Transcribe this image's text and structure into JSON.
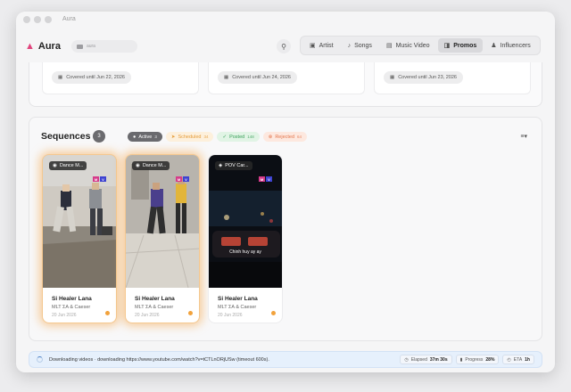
{
  "window": {
    "title": "Aura"
  },
  "header": {
    "logo_text": "Aura",
    "search_placeholder": "aura",
    "nav": [
      {
        "label": "Artist",
        "icon": "contact-card-icon",
        "active": false
      },
      {
        "label": "Songs",
        "icon": "music-note-icon",
        "active": false
      },
      {
        "label": "Music Video",
        "icon": "video-icon",
        "active": false
      },
      {
        "label": "Promos",
        "icon": "megaphone-icon",
        "active": true
      },
      {
        "label": "Influencers",
        "icon": "users-icon",
        "active": false
      }
    ]
  },
  "promo_cards": [
    {
      "coverage": "Covered until Jun 22, 2026"
    },
    {
      "coverage": "Covered until Jun 24, 2026"
    },
    {
      "coverage": "Covered until Jun 23, 2026"
    }
  ],
  "sequences": {
    "title": "Sequences",
    "count": "3",
    "filters": [
      {
        "label": "Active",
        "count": "3"
      },
      {
        "label": "Scheduled",
        "count": "34"
      },
      {
        "label": "Posted",
        "count": "148"
      },
      {
        "label": "Rejected",
        "count": "64"
      }
    ],
    "cards": [
      {
        "badge": "Dance M...",
        "mv_m": "M",
        "mv_v": "V",
        "title": "Si Healer Lana",
        "artist": "MLT ΣA & Caeser",
        "date": "20 Jun 2026",
        "caption": ""
      },
      {
        "badge": "Dance M...",
        "mv_m": "M",
        "mv_v": "V",
        "title": "Si Healer Lana",
        "artist": "MLT ΣA & Caeser",
        "date": "20 Jun 2026",
        "caption": ""
      },
      {
        "badge": "POV Car...",
        "mv_m": "M",
        "mv_v": "V",
        "title": "Si Healer Lana",
        "artist": "MLT ΣA & Caeser",
        "date": "20 Jun 2026",
        "caption": "Chinh huy ay ay"
      }
    ]
  },
  "statusbar": {
    "message": "Downloading videos · downloading https://www.youtube.com/watch?v=tCTLnORjUSw (timeout 600s).",
    "elapsed_label": "Elapsed",
    "elapsed_value": "37m 30s",
    "progress_label": "Progress",
    "progress_value": "28%",
    "eta_label": "ETA",
    "eta_value": "1h"
  },
  "colors": {
    "accent_pink": "#e0447c",
    "glow": "#f5aa50",
    "status_dot": "#f2a23c",
    "active_chip": "#6a6a6e"
  }
}
